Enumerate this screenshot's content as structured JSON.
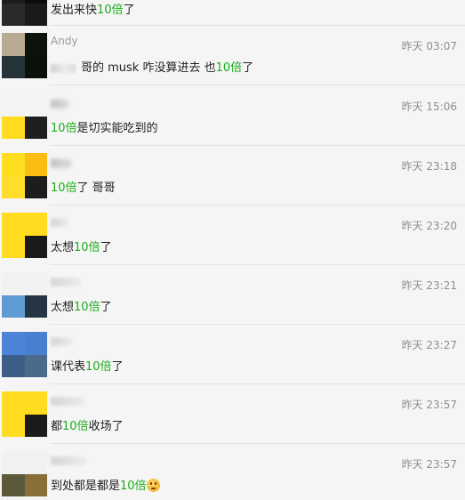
{
  "messages": [
    {
      "name": "",
      "time": "",
      "text_before": "发出来快",
      "highlight": "10倍",
      "text_after": "了",
      "avatar_colors": [
        "#1c1c1c",
        "#0b0b0b",
        "#2a2a2a",
        "#1a1a1a"
      ]
    },
    {
      "name": "Andy",
      "time": "昨天 03:07",
      "text_before": "哥的 musk 咋没算进去 也",
      "highlight": "10倍",
      "text_after": "了",
      "avatar_colors": [
        "#b8ab92",
        "#0c120c",
        "#27333a",
        "#09110a"
      ]
    },
    {
      "name": "UU",
      "time": "昨天 15:06",
      "text_before": "",
      "highlight": "10倍",
      "text_after": "是切实能吃到的",
      "avatar_colors": [
        "#f4f4f4",
        "#f4f4f4",
        "#ffdc1f",
        "#1f1f1f"
      ]
    },
    {
      "name": "919",
      "time": "昨天 23:18",
      "text_before": "",
      "highlight": "10倍",
      "text_after": "了 哥哥",
      "avatar_colors": [
        "#ffdd1f",
        "#fbbd14",
        "#ffdd2a",
        "#1d1d1d"
      ]
    },
    {
      "name": "",
      "time": "昨天 23:20",
      "text_before": "太想",
      "highlight": "10倍",
      "text_after": "了",
      "avatar_colors": [
        "#ffdc1f",
        "#ffdc1f",
        "#ffdc1f",
        "#1a1a1a"
      ]
    },
    {
      "name": "",
      "time": "昨天 23:21",
      "text_before": "太想",
      "highlight": "10倍",
      "text_after": "了",
      "avatar_colors": [
        "#f2f2f2",
        "#f2f2f2",
        "#5e9bd2",
        "#263544"
      ]
    },
    {
      "name": "",
      "time": "昨天 23:27",
      "text_before": "课代表",
      "highlight": "10倍",
      "text_after": "了",
      "avatar_colors": [
        "#4c85d8",
        "#4a7fd0",
        "#3d5f87",
        "#4b6b8c"
      ]
    },
    {
      "name": "",
      "time": "昨天 23:57",
      "text_before": "都",
      "highlight": "10倍",
      "text_after": "收场了",
      "avatar_colors": [
        "#ffdc1f",
        "#ffdc1f",
        "#ffdc1f",
        "#1b1b1b"
      ]
    },
    {
      "name": "",
      "time": "昨天 23:57",
      "text_before": "到处都是都是",
      "highlight": "10倍",
      "text_after": "",
      "emoji": "thinking-emoji",
      "avatar_colors": [
        "#f1f1f1",
        "#f1f1f1",
        "#5d5a3b",
        "#8a6e3a"
      ]
    }
  ],
  "colors": {
    "highlight": "#1aad19",
    "time": "#8f8f8f",
    "name": "#9a9a9a",
    "background": "#f5f5f5"
  }
}
